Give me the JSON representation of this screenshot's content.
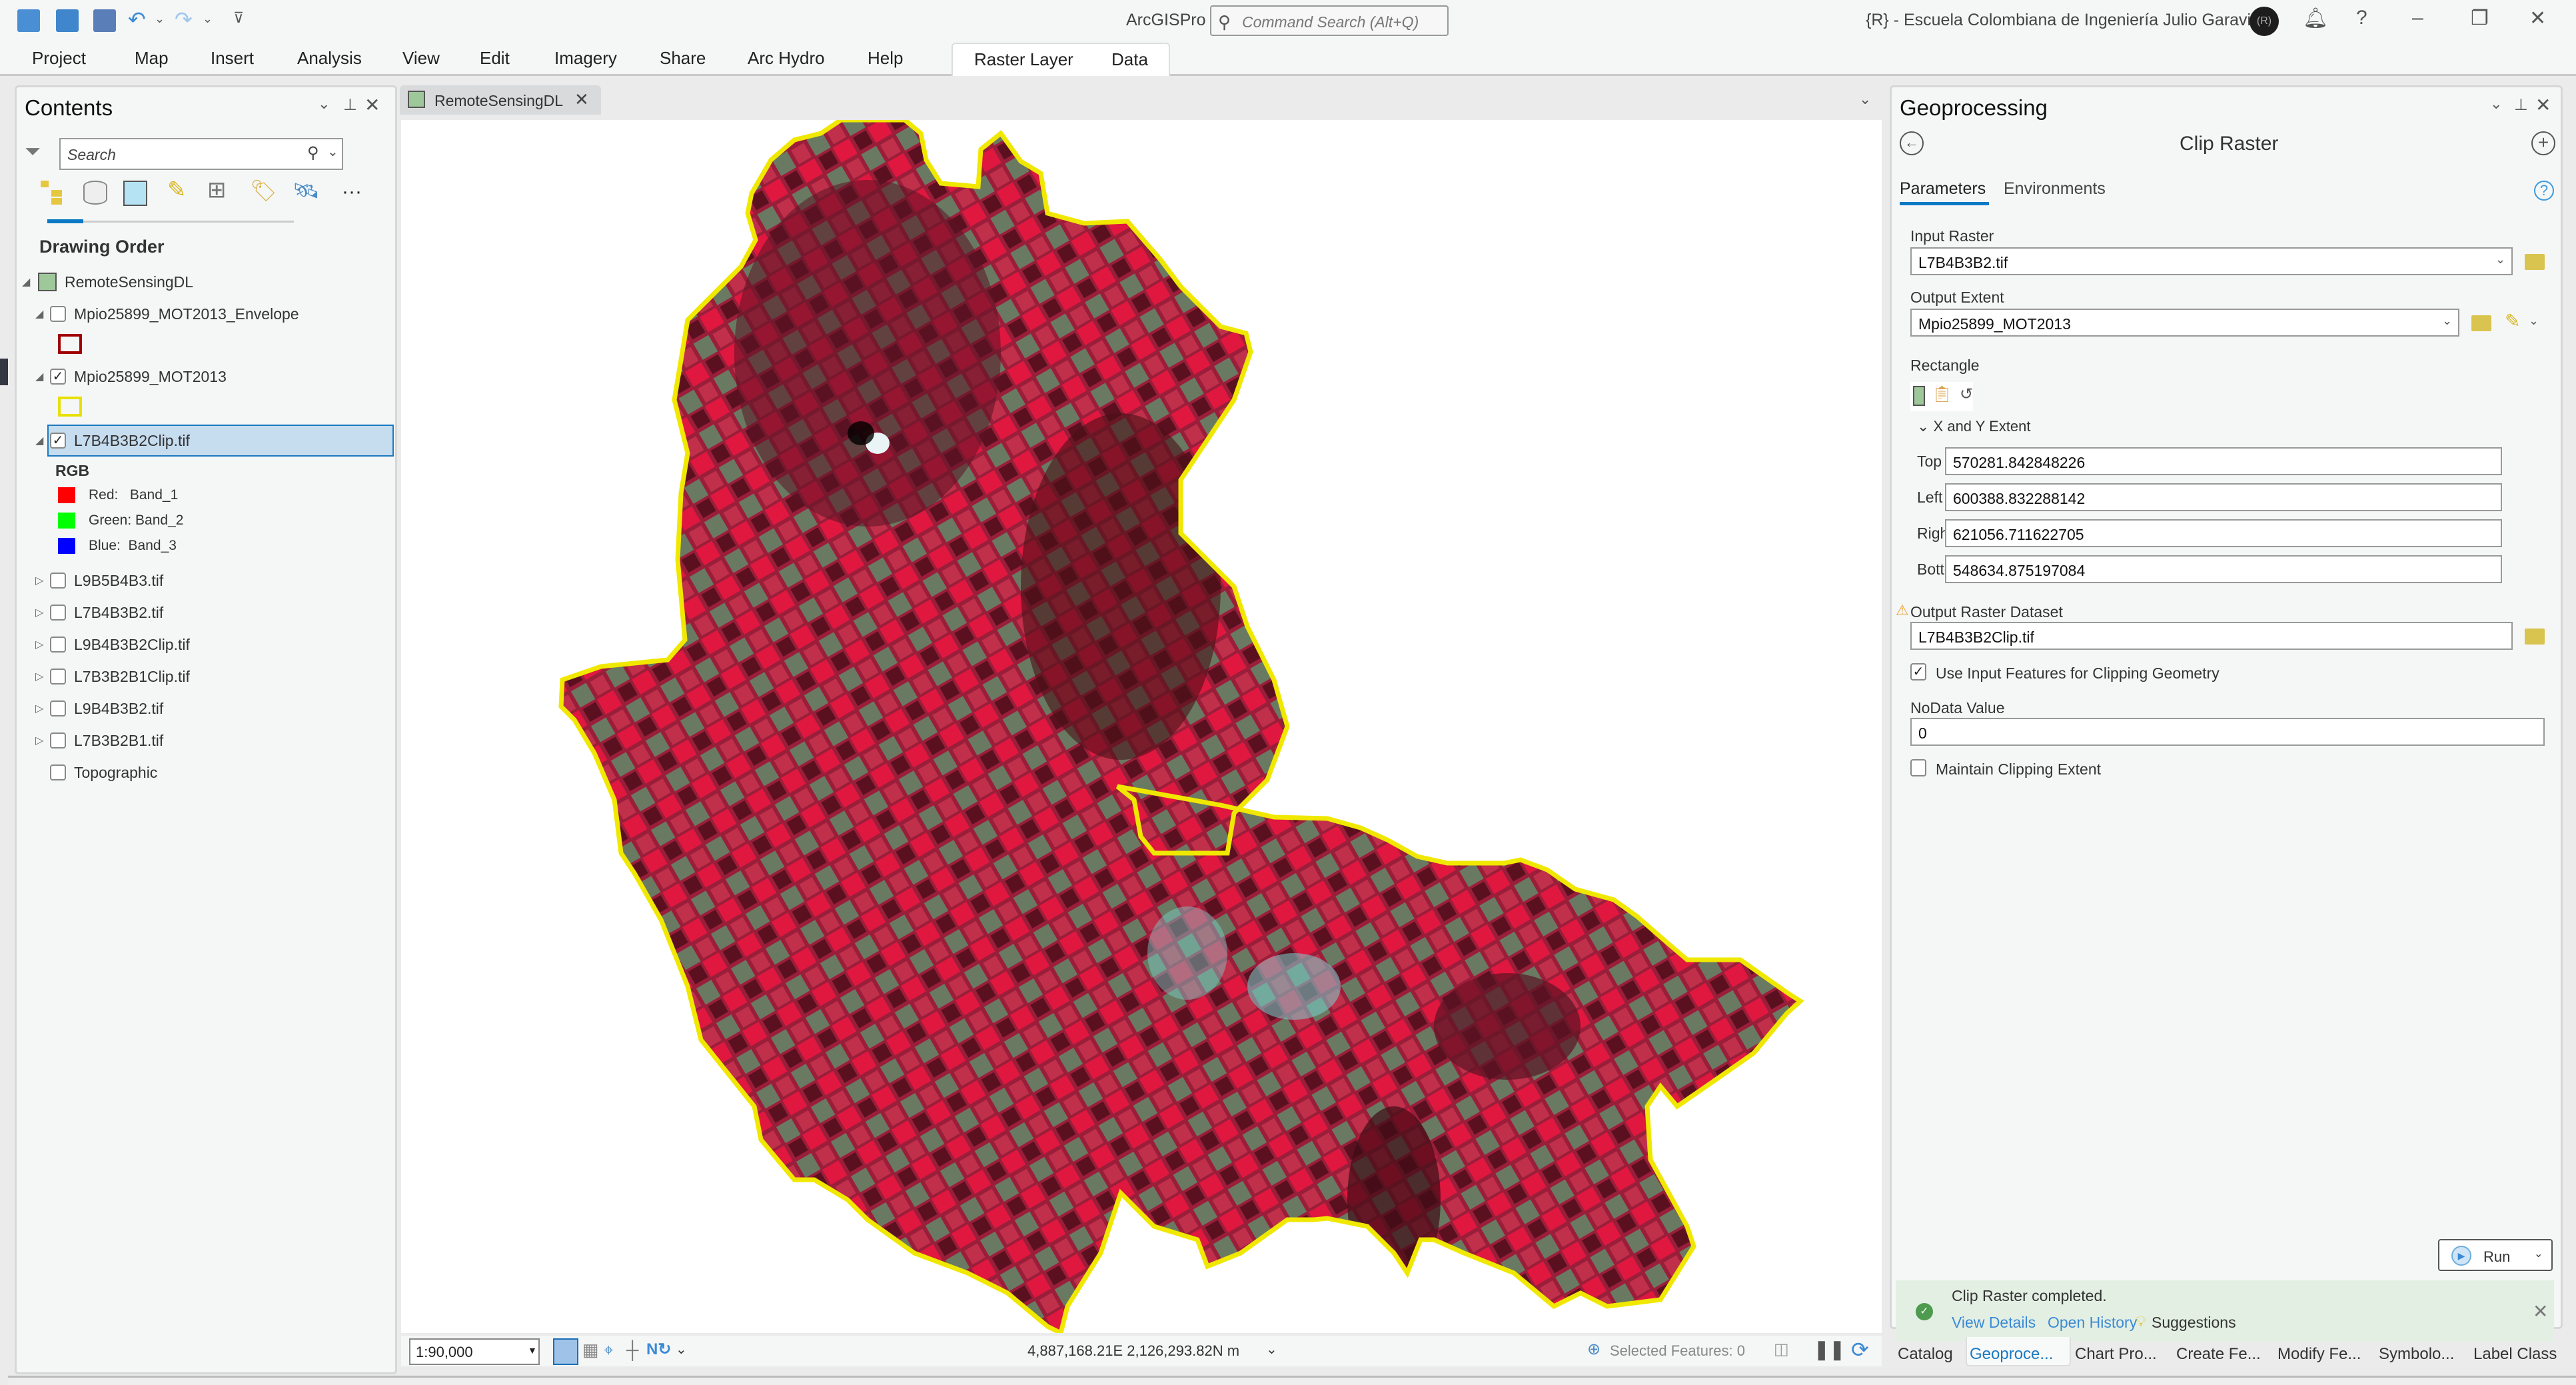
{
  "titlebar": {
    "app_name": "ArcGISPro",
    "command_search_placeholder": "Command Search (Alt+Q)",
    "organization": "{R} - Escuela Colombiana de Ingeniería Julio Garavito",
    "avatar_initials": "(R)"
  },
  "ribbon": {
    "tabs": [
      "Project",
      "Map",
      "Insert",
      "Analysis",
      "View",
      "Edit",
      "Imagery",
      "Share",
      "Arc Hydro",
      "Help"
    ],
    "contextual_tabs": [
      "Raster Layer",
      "Data"
    ]
  },
  "contents": {
    "title": "Contents",
    "search_placeholder": "Search",
    "section": "Drawing Order",
    "map_name": "RemoteSensingDL",
    "layers": [
      {
        "name": "Mpio25899_MOT2013_Envelope",
        "checked": false,
        "expanded": true,
        "symbol_color": "#a00000"
      },
      {
        "name": "Mpio25899_MOT2013",
        "checked": true,
        "expanded": true,
        "symbol_color": "#e8e000"
      },
      {
        "name": "L7B4B3B2Clip.tif",
        "checked": true,
        "expanded": true,
        "selected": true
      },
      {
        "name": "L9B5B4B3.tif",
        "checked": false,
        "expanded": false
      },
      {
        "name": "L7B4B3B2.tif",
        "checked": false,
        "expanded": false
      },
      {
        "name": "L9B4B3B2Clip.tif",
        "checked": false,
        "expanded": false
      },
      {
        "name": "L7B3B2B1Clip.tif",
        "checked": false,
        "expanded": false
      },
      {
        "name": "L9B4B3B2.tif",
        "checked": false,
        "expanded": false
      },
      {
        "name": "L7B3B2B1.tif",
        "checked": false,
        "expanded": false
      },
      {
        "name": "Topographic",
        "checked": false,
        "expanded": false
      }
    ],
    "rgb_legend": {
      "title": "RGB",
      "bands": [
        {
          "label": "Red:",
          "band": "Band_1",
          "color": "#ff0000"
        },
        {
          "label": "Green:",
          "band": "Band_2",
          "color": "#00ff00"
        },
        {
          "label": "Blue:",
          "band": "Band_3",
          "color": "#0000ff"
        }
      ]
    }
  },
  "map": {
    "tab_label": "RemoteSensingDL",
    "scale": "1:90,000",
    "coordinates": "4,887,168.21E 2,126,293.82N m",
    "selected_features": "Selected Features: 0",
    "boundary_color": "#f0e800"
  },
  "geoprocessing": {
    "title": "Geoprocessing",
    "tool_name": "Clip Raster",
    "tabs": [
      "Parameters",
      "Environments"
    ],
    "input_raster_label": "Input Raster",
    "input_raster_value": "L7B4B3B2.tif",
    "output_extent_label": "Output Extent",
    "output_extent_value": "Mpio25899_MOT2013",
    "rectangle_label": "Rectangle",
    "xy_extent_label": "X and Y Extent",
    "extent": [
      {
        "label": "Top",
        "value": "570281.842848226"
      },
      {
        "label": "Left",
        "value": "600388.832288142"
      },
      {
        "label": "Right",
        "value": "621056.711622705"
      },
      {
        "label": "Bottom",
        "value": "548634.875197084"
      }
    ],
    "output_raster_label": "Output Raster Dataset",
    "output_raster_value": "L7B4B3B2Clip.tif",
    "use_input_features_label": "Use Input Features for Clipping Geometry",
    "use_input_features_checked": true,
    "nodata_label": "NoData Value",
    "nodata_value": "0",
    "maintain_extent_label": "Maintain Clipping Extent",
    "maintain_extent_checked": false,
    "run_label": "Run",
    "message": "Clip Raster completed.",
    "links": [
      "View Details",
      "Open History",
      "Suggestions"
    ]
  },
  "bottom_tabs": [
    "Catalog",
    "Geoproce...",
    "Chart Pro...",
    "Create Fe...",
    "Modify Fe...",
    "Symbolo...",
    "Label Class"
  ]
}
